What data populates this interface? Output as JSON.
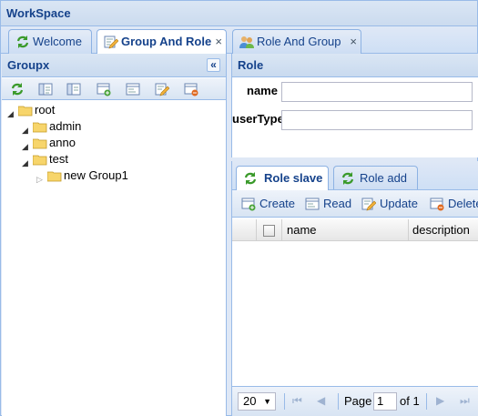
{
  "app": {
    "title": "WorkSpace"
  },
  "tabs": [
    {
      "label": "Welcome",
      "icon": "refresh-icon",
      "closable": false,
      "active": false
    },
    {
      "label": "Group And Role",
      "icon": "edit-icon",
      "closable": true,
      "active": true
    },
    {
      "label": "Role And Group",
      "icon": "users-icon",
      "closable": true,
      "active": false
    }
  ],
  "tab_close": "×",
  "left_panel": {
    "title": "Groupx",
    "collapse_glyph": "«",
    "tree": {
      "root": "root",
      "children": [
        "admin",
        "anno",
        "test"
      ],
      "grandchild": "new Group1"
    }
  },
  "role_panel": {
    "title": "Role",
    "fields": [
      {
        "label": "name",
        "value": ""
      },
      {
        "label": "userType",
        "value": ""
      }
    ]
  },
  "sub_tabs": [
    {
      "label": "Role slave",
      "active": true
    },
    {
      "label": "Role add",
      "active": false
    }
  ],
  "grid_toolbar": {
    "create": "Create",
    "read": "Read",
    "update": "Update",
    "delete": "Delete"
  },
  "grid": {
    "columns": [
      "name",
      "description"
    ]
  },
  "pager": {
    "page_size": "20",
    "page_label": "Page",
    "page_value": "1",
    "of_label": "of 1"
  }
}
